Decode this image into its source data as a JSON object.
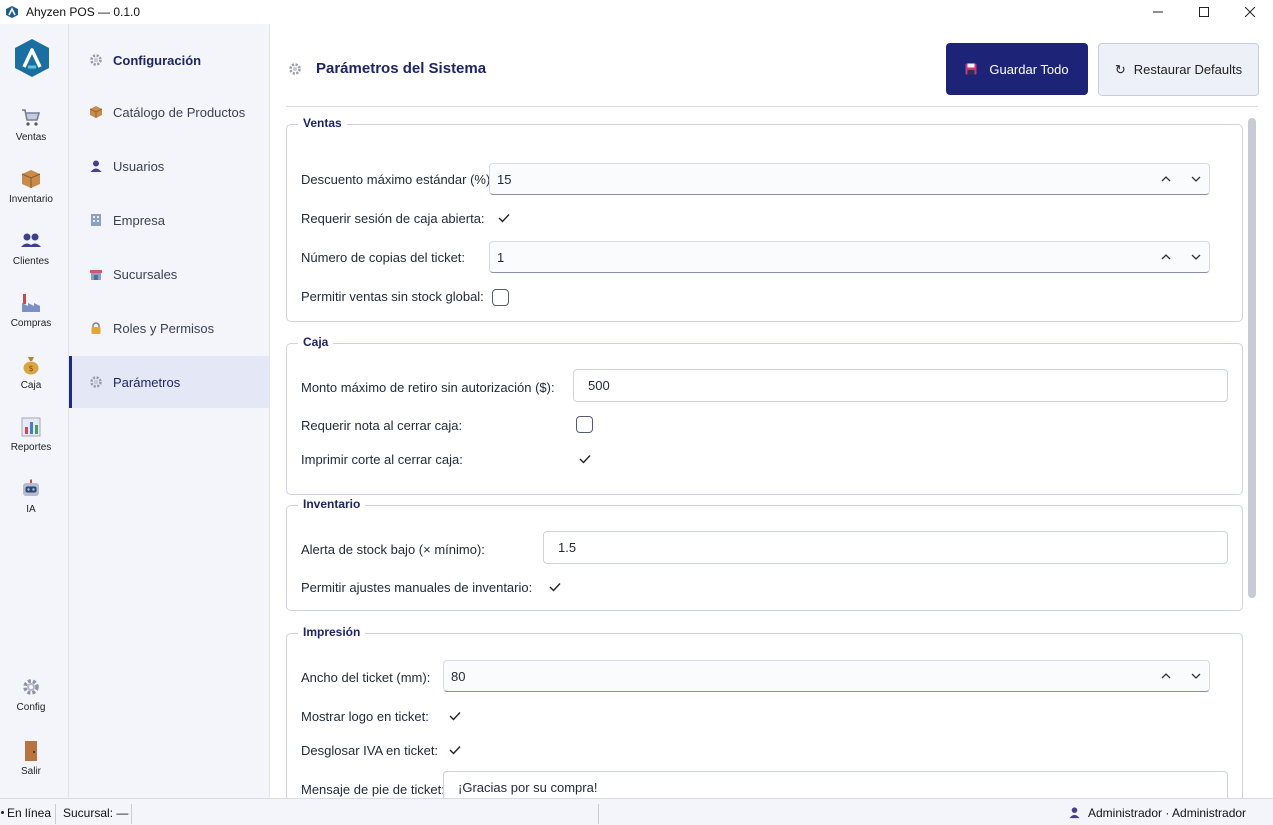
{
  "window": {
    "title": "Ahyzen POS — 0.1.0"
  },
  "nav": {
    "items": [
      {
        "label": "Ventas",
        "icon": "cart-icon"
      },
      {
        "label": "Inventario",
        "icon": "box-icon"
      },
      {
        "label": "Clientes",
        "icon": "users-icon"
      },
      {
        "label": "Compras",
        "icon": "factory-icon"
      },
      {
        "label": "Caja",
        "icon": "money-bag-icon"
      },
      {
        "label": "Reportes",
        "icon": "bar-chart-icon"
      },
      {
        "label": "IA",
        "icon": "robot-icon"
      }
    ],
    "config_label": "Config",
    "exit_label": "Salir"
  },
  "sidebar": {
    "header": "Configuración",
    "items": [
      {
        "label": "Catálogo de Productos",
        "icon": "package-icon"
      },
      {
        "label": "Usuarios",
        "icon": "user-icon"
      },
      {
        "label": "Empresa",
        "icon": "building-icon"
      },
      {
        "label": "Sucursales",
        "icon": "store-icon"
      },
      {
        "label": "Roles y Permisos",
        "icon": "lock-icon"
      },
      {
        "label": "Parámetros",
        "icon": "gear-icon",
        "active": true
      }
    ]
  },
  "header": {
    "title": "Parámetros del Sistema",
    "save_label": "Guardar Todo",
    "restore_label": "Restaurar Defaults"
  },
  "groups": {
    "ventas": {
      "legend": "Ventas",
      "descuento_label": "Descuento máximo estándar (%):",
      "descuento_value": "15",
      "sesion_label": "Requerir sesión de caja abierta:",
      "sesion_checked": true,
      "copias_label": "Número de copias del ticket:",
      "copias_value": "1",
      "sin_stock_label": "Permitir ventas sin stock global:",
      "sin_stock_checked": false
    },
    "caja": {
      "legend": "Caja",
      "retiro_label": "Monto máximo de retiro sin autorización ($):",
      "retiro_value": "500",
      "nota_label": "Requerir nota al cerrar caja:",
      "nota_checked": false,
      "corte_label": "Imprimir corte al cerrar caja:",
      "corte_checked": true
    },
    "inventario": {
      "legend": "Inventario",
      "alerta_label": "Alerta de stock bajo (× mínimo):",
      "alerta_value": "1.5",
      "ajustes_label": "Permitir ajustes manuales de inventario:",
      "ajustes_checked": true
    },
    "impresion": {
      "legend": "Impresión",
      "ancho_label": "Ancho del ticket (mm):",
      "ancho_value": "80",
      "logo_label": "Mostrar logo en ticket:",
      "logo_checked": true,
      "iva_label": "Desglosar IVA en ticket:",
      "iva_checked": true,
      "mensaje_label": "Mensaje de pie de ticket:",
      "mensaje_value": "¡Gracias por su compra!"
    }
  },
  "statusbar": {
    "connection": "En línea",
    "sucursal": "Sucursal: —",
    "user": "Administrador · Administrador"
  },
  "colors": {
    "accent": "#1d2478",
    "sidebar_bg": "#f4f5fa",
    "active_bg": "#e4e7f5"
  }
}
